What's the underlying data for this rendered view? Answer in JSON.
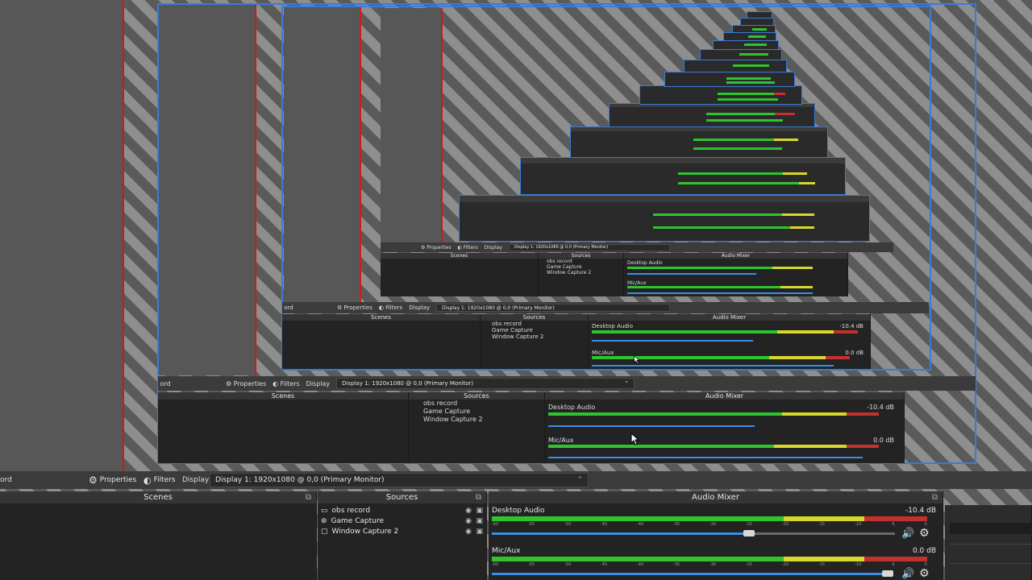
{
  "toolbar": {
    "left_fragment": "ord",
    "properties_label": "Properties",
    "filters_label": "Filters",
    "display_label": "Display",
    "display_value": "Display 1: 1920x1080 @ 0,0 (Primary Monitor)"
  },
  "scenes": {
    "title": "Scenes"
  },
  "sources": {
    "title": "Sources",
    "items": [
      {
        "label": "obs record",
        "icon": "monitor-icon"
      },
      {
        "label": "Game Capture",
        "icon": "gamepad-icon"
      },
      {
        "label": "Window Capture 2",
        "icon": "window-icon"
      }
    ]
  },
  "mixer": {
    "title": "Audio Mixer",
    "channels": [
      {
        "name": "Desktop Audio",
        "db": "-10.4 dB",
        "level": 0.7
      },
      {
        "name": "Mic/Aux",
        "db": "0.0 dB",
        "level": 0.98
      }
    ],
    "scale": [
      "-60",
      "-55",
      "-50",
      "-45",
      "-40",
      "-35",
      "-30",
      "-25",
      "-20",
      "-15",
      "-10",
      "-5",
      "0"
    ]
  },
  "colors": {
    "accent": "#3a7bd5",
    "meter_green": "#2fc42f",
    "meter_yellow": "#d8d82a",
    "meter_red": "#c42f2f",
    "slider_blue": "#3a8ee6",
    "guide_red": "#d01818"
  }
}
